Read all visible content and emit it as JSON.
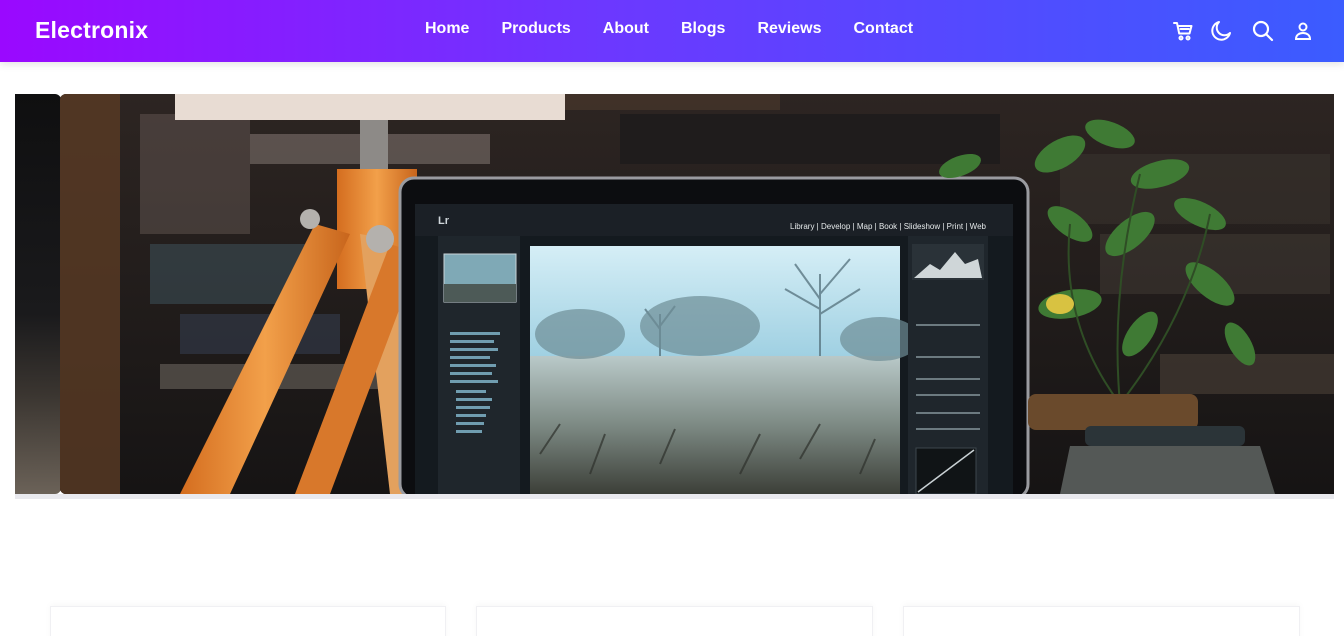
{
  "brand": {
    "name": "Electronix"
  },
  "nav": {
    "links": [
      {
        "label": "Home"
      },
      {
        "label": "Products"
      },
      {
        "label": "About"
      },
      {
        "label": "Blogs"
      },
      {
        "label": "Reviews"
      },
      {
        "label": "Contact"
      }
    ],
    "icons": [
      "cart-icon",
      "moon-icon",
      "search-icon",
      "user-icon"
    ]
  },
  "hero": {
    "images": [
      "laptop-on-desk-photo"
    ]
  },
  "colors": {
    "nav_gradient_start": "#9a08ff",
    "nav_gradient_end": "#3b5cff"
  }
}
